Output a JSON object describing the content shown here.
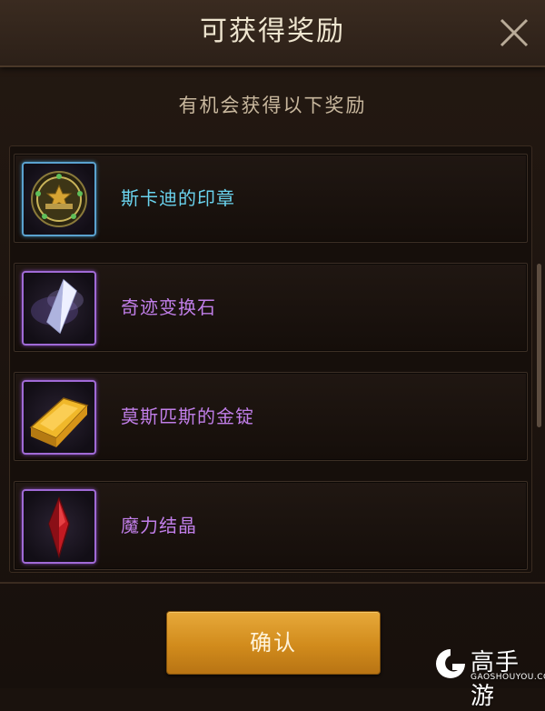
{
  "dialog": {
    "title": "可获得奖励",
    "subtitle": "有机会获得以下奖励",
    "confirm_label": "确认"
  },
  "rewards": [
    {
      "name": "斯卡迪的印章",
      "rarity_color": "#6ad3ee",
      "icon": "seal-icon"
    },
    {
      "name": "奇迹变换石",
      "rarity_color": "#c07ee8",
      "icon": "crystal-icon"
    },
    {
      "name": "莫斯匹斯的金锭",
      "rarity_color": "#c07ee8",
      "icon": "gold-ingot-icon"
    },
    {
      "name": "魔力结晶",
      "rarity_color": "#c07ee8",
      "icon": "red-crystal-icon"
    }
  ],
  "watermark": {
    "brand": "高手游",
    "domain": "GAOSHOUYOU.COM"
  }
}
